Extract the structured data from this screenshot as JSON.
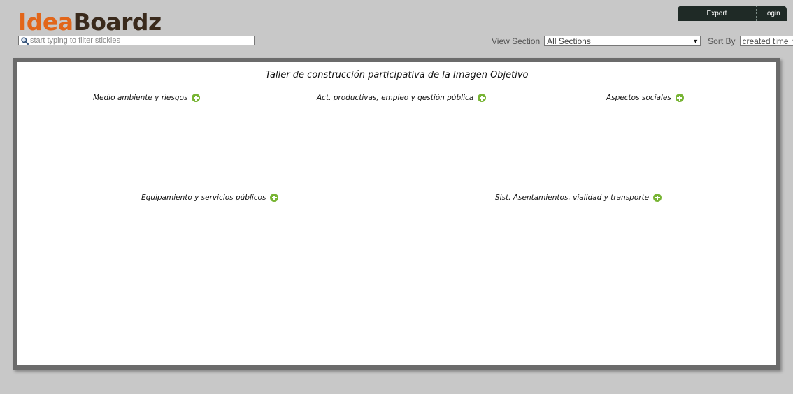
{
  "app": {
    "logo_part1": "Idea",
    "logo_part2": "Boardz"
  },
  "filter": {
    "placeholder": "start typing to filter stickies"
  },
  "topbar": {
    "export_label": "Export",
    "login_label": "Login"
  },
  "controls": {
    "view_section_label": "View Section",
    "view_section_value": "All Sections",
    "sort_by_label": "Sort By",
    "sort_by_value": "created time"
  },
  "board": {
    "title": "Taller de construcción participativa de la Imagen Objetivo",
    "sections": [
      {
        "label": "Medio ambiente y riesgos"
      },
      {
        "label": "Act. productivas, empleo y gestión pública"
      },
      {
        "label": "Aspectos sociales"
      },
      {
        "label": "Equipamiento y servicios públicos"
      },
      {
        "label": "Sist. Asentamientos, vialidad y transporte"
      }
    ]
  },
  "colors": {
    "logo_orange": "#e2661a",
    "logo_brown": "#3a2a1c",
    "add_green": "#77b433",
    "topbar_dark": "#1f2a26",
    "board_border": "#6b6b6b",
    "background": "#c8c8c8"
  },
  "icons": {
    "filter": "magnifier-icon",
    "add": "plus-circle-icon",
    "dropdown": "chevron-down-icon"
  }
}
